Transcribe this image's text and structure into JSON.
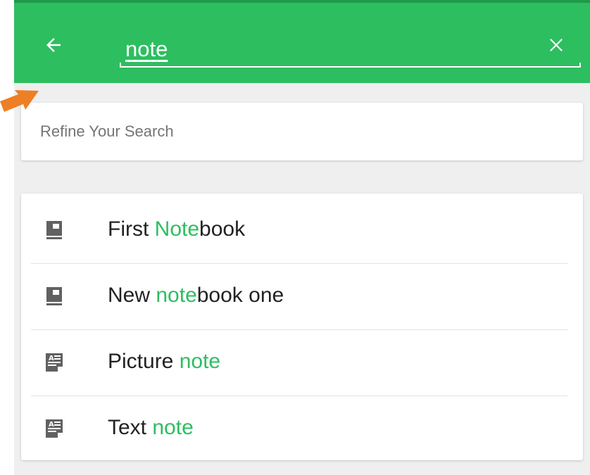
{
  "colors": {
    "accent": "#2dbe60",
    "header_edge": "#1f9a49",
    "icon_gray": "#616161",
    "pointer_orange": "#ee7f25"
  },
  "header": {
    "back_icon": "arrow-left-icon",
    "search_value": "note",
    "clear_icon": "close-icon"
  },
  "refine": {
    "label": "Refine Your Search"
  },
  "results": [
    {
      "type": "notebook",
      "icon": "notebook-icon",
      "pre": "First ",
      "match": "Note",
      "post": "book"
    },
    {
      "type": "notebook",
      "icon": "notebook-icon",
      "pre": "New ",
      "match": "note",
      "post": "book one"
    },
    {
      "type": "note",
      "icon": "note-icon",
      "pre": "Picture ",
      "match": "note",
      "post": ""
    },
    {
      "type": "note",
      "icon": "note-icon",
      "pre": "Text ",
      "match": "note",
      "post": ""
    }
  ]
}
